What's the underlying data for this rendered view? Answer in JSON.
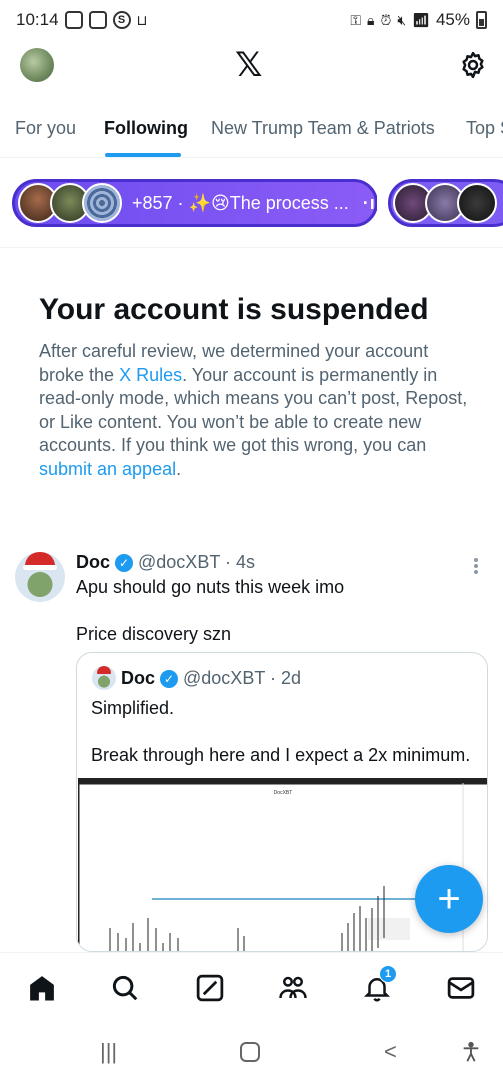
{
  "status_bar": {
    "time": "10:14",
    "battery": "45%"
  },
  "header": {
    "logo": "𝕏"
  },
  "tabs": [
    {
      "label": "For you",
      "active": false
    },
    {
      "label": "Following",
      "active": true
    },
    {
      "label": "New Trump Team & Patriots",
      "active": false
    },
    {
      "label": "Top S",
      "active": false
    }
  ],
  "spaces": {
    "pill_text": "+857 · ✨😢The process ...",
    "pill_bars": "·ıl"
  },
  "suspended": {
    "title": "Your account is suspended",
    "text_before_rules": "After careful review, we determined your account broke the ",
    "rules_link": "X Rules",
    "text_after_rules": ". Your account is permanently in read-only mode, which means you can’t post, Repost, or Like content. You won’t be able to create new accounts. If you think we got this wrong, you can ",
    "appeal_link": "submit an appeal",
    "text_end": "."
  },
  "tweet": {
    "name": "Doc",
    "handle": "@docXBT · 4s",
    "text1": "Apu should go nuts this week imo",
    "text2": "Price discovery szn",
    "quote": {
      "name": "Doc",
      "handle": "@docXBT · 2d",
      "text1": "Simplified.",
      "text2": "Break through here and I expect a 2x minimum."
    }
  },
  "fab": {
    "label": "+"
  },
  "bottom_nav": {
    "notifications_badge": "1",
    "items": [
      "home-icon",
      "search-icon",
      "grok-icon",
      "communities-icon",
      "notifications-icon",
      "messages-icon"
    ]
  },
  "colors": {
    "accent": "#1d9bf0",
    "space_pill": "#7c5cf2",
    "muted": "#536471"
  }
}
